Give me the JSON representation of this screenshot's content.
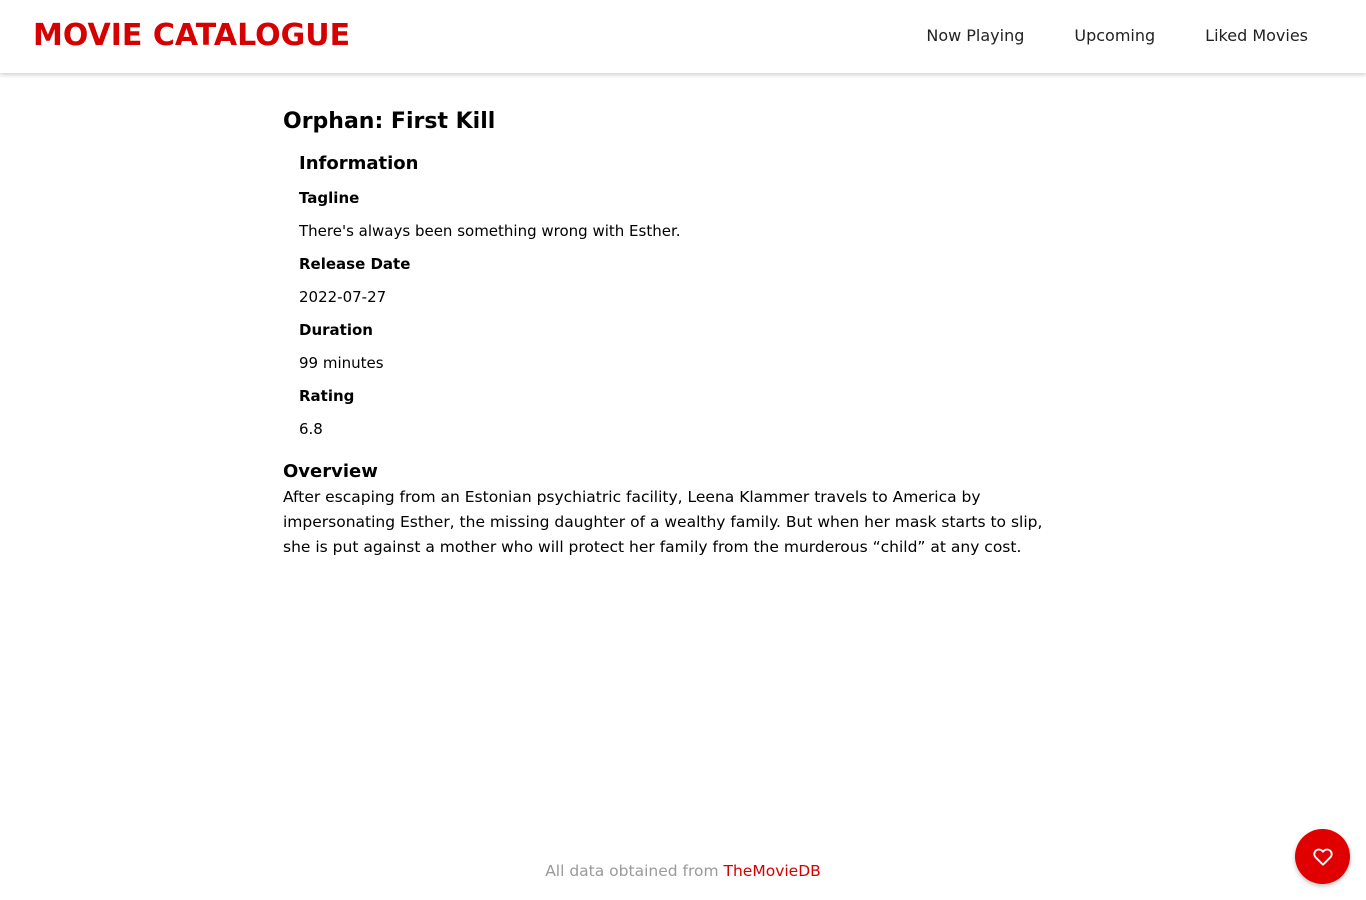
{
  "header": {
    "brand": "MOVIE CATALOGUE",
    "nav": [
      {
        "label": "Now Playing"
      },
      {
        "label": "Upcoming"
      },
      {
        "label": "Liked Movies"
      }
    ]
  },
  "movie": {
    "title": "Orphan: First Kill",
    "information": {
      "heading": "Information",
      "tagline_label": "Tagline",
      "tagline": "There's always been something wrong with Esther.",
      "release_date_label": "Release Date",
      "release_date": "2022-07-27",
      "duration_label": "Duration",
      "duration": "99 minutes",
      "rating_label": "Rating",
      "rating": "6.8"
    },
    "overview": {
      "heading": "Overview",
      "text": "After escaping from an Estonian psychiatric facility, Leena Klammer travels to America by impersonating Esther, the missing daughter of a wealthy family. But when her mask starts to slip, she is put against a mother who will protect her family from the murderous “child” at any cost."
    }
  },
  "footer": {
    "prefix": "All data obtained from ",
    "source_link": "TheMovieDB"
  },
  "fab": {
    "icon": "heart-outline-icon"
  },
  "colors": {
    "accent": "#d60000",
    "fab": "#e00000",
    "footer_text": "#9a9a9a"
  }
}
